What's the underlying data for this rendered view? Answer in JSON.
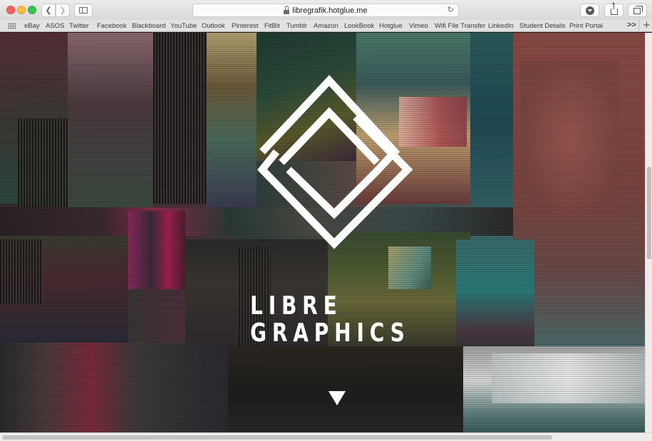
{
  "browser": {
    "url": "libregrafik.hotglue.me",
    "bookmarks": [
      "eBay",
      "ASOS",
      "Twitter",
      "Facebook",
      "Blackboard",
      "YouTube",
      "Outlook",
      "Pinterest",
      "FitBit",
      "Tumblr",
      "Amazon",
      "LookBook",
      "Hotglue",
      "Vimeo",
      "Wifi File Transfer",
      "LinkedIn",
      "Student Details",
      "Print Portal"
    ],
    "more_label": ">>",
    "add_label": "+",
    "icons": {
      "back": "chevron-left-icon",
      "forward": "chevron-right-icon",
      "sidebar": "sidebar-icon",
      "secure": "lock-icon",
      "reload": "reload-icon",
      "download": "download-icon",
      "share": "share-icon",
      "tabs": "tabs-overview-icon",
      "bookmarks": "grid-icon"
    }
  },
  "page": {
    "brand_line1": "LIBRE",
    "brand_line2": "GRAPHICS",
    "scroll_hint_icon": "triangle-down-icon",
    "logo_icon": "interlocking-diamond-logo",
    "colors": {
      "logo": "#ffffff",
      "background": "#2a1e22"
    }
  }
}
